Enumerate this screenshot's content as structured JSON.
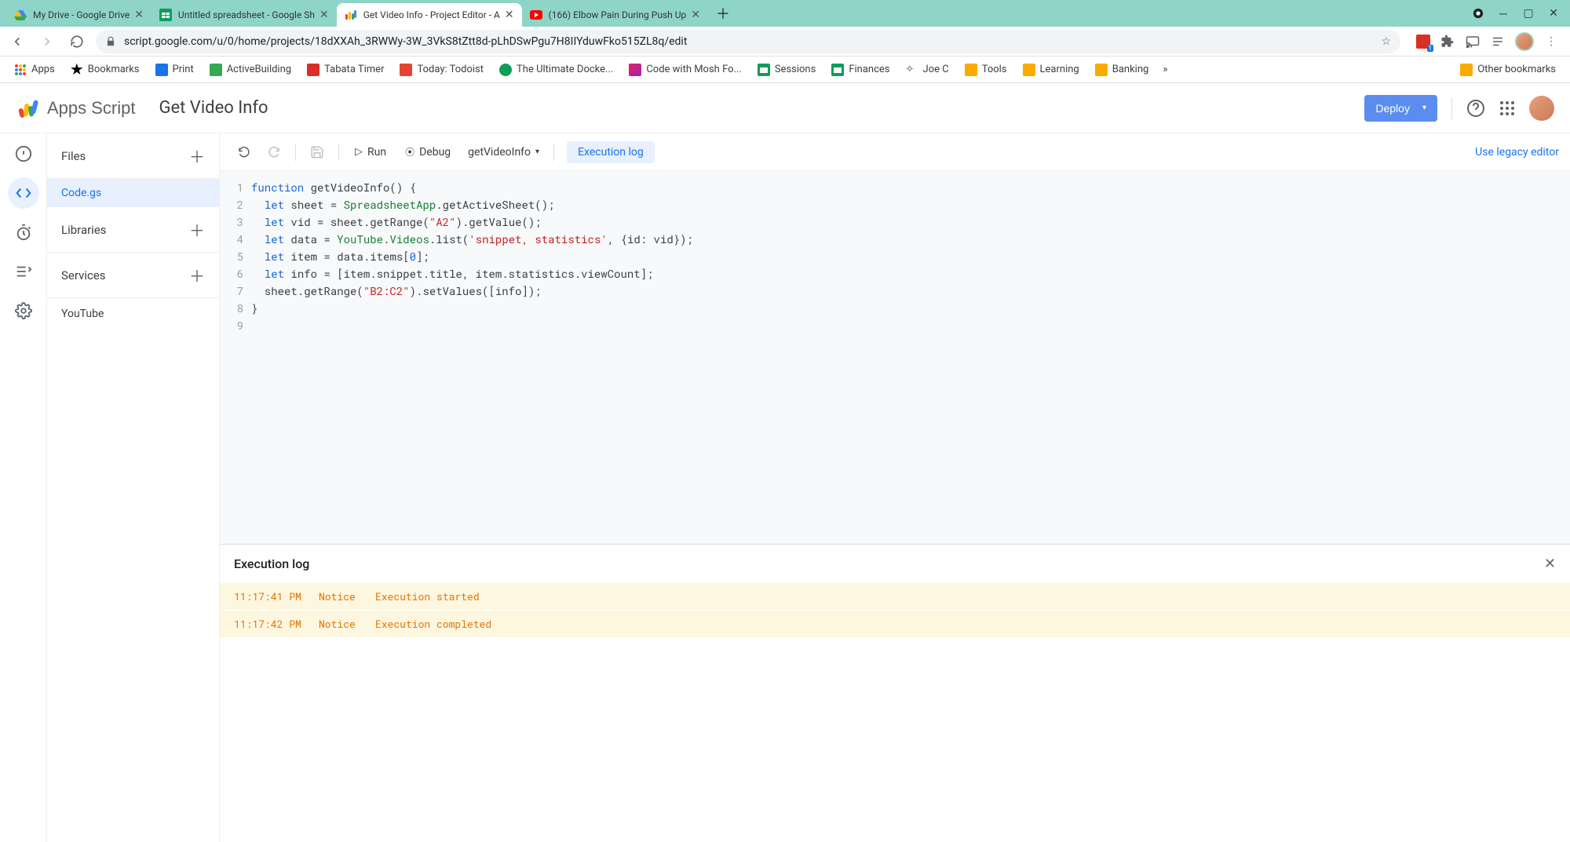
{
  "browser": {
    "tabs": [
      {
        "title": "My Drive - Google Drive",
        "favicon": "drive",
        "active": false
      },
      {
        "title": "Untitled spreadsheet - Google Sh",
        "favicon": "sheets",
        "active": false
      },
      {
        "title": "Get Video Info - Project Editor - A",
        "favicon": "script",
        "active": true
      },
      {
        "title": "(166) Elbow Pain During Push Up",
        "favicon": "youtube",
        "active": false
      }
    ],
    "url": "script.google.com/u/0/home/projects/18dXXAh_3RWWy-3W_3VkS8tZtt8d-pLhDSwPgu7H8IIYduwFko515ZL8q/edit",
    "bookmarks": [
      {
        "label": "Apps",
        "type": "apps"
      },
      {
        "label": "Bookmarks",
        "type": "star"
      },
      {
        "label": "Print",
        "type": "custom"
      },
      {
        "label": "ActiveBuilding",
        "type": "custom"
      },
      {
        "label": "Tabata Timer",
        "type": "custom"
      },
      {
        "label": "Today: Todoist",
        "type": "custom"
      },
      {
        "label": "The Ultimate Docke...",
        "type": "custom"
      },
      {
        "label": "Code with Mosh Fo...",
        "type": "custom"
      },
      {
        "label": "Sessions",
        "type": "sheets"
      },
      {
        "label": "Finances",
        "type": "sheets"
      },
      {
        "label": "Joe C",
        "type": "custom"
      },
      {
        "label": "Tools",
        "type": "folder"
      },
      {
        "label": "Learning",
        "type": "folder"
      },
      {
        "label": "Banking",
        "type": "folder"
      }
    ],
    "other_bookmarks": "Other bookmarks",
    "overflow": "»"
  },
  "header": {
    "brand": "Apps Script",
    "project_name": "Get Video Info",
    "deploy": "Deploy",
    "legacy_link": "Use legacy editor"
  },
  "rail": {
    "items": [
      "info",
      "editor",
      "triggers",
      "executions",
      "settings"
    ],
    "active": "editor"
  },
  "files_panel": {
    "files_label": "Files",
    "libraries_label": "Libraries",
    "services_label": "Services",
    "files": [
      "Code.gs"
    ],
    "services": [
      "YouTube"
    ]
  },
  "toolbar": {
    "run": "Run",
    "debug": "Debug",
    "function_selected": "getVideoInfo",
    "execution_log": "Execution log"
  },
  "code": {
    "line_count": 9,
    "tokens": [
      [
        {
          "t": "function",
          "c": "kw"
        },
        {
          "t": " getVideoInfo() {",
          "c": ""
        }
      ],
      [
        {
          "t": "  ",
          "c": ""
        },
        {
          "t": "let",
          "c": "kw"
        },
        {
          "t": " sheet = ",
          "c": ""
        },
        {
          "t": "SpreadsheetApp",
          "c": "cls"
        },
        {
          "t": ".getActiveSheet();",
          "c": ""
        }
      ],
      [
        {
          "t": "  ",
          "c": ""
        },
        {
          "t": "let",
          "c": "kw"
        },
        {
          "t": " vid = sheet.getRange(",
          "c": ""
        },
        {
          "t": "\"A2\"",
          "c": "str"
        },
        {
          "t": ").getValue();",
          "c": ""
        }
      ],
      [
        {
          "t": "  ",
          "c": ""
        },
        {
          "t": "let",
          "c": "kw"
        },
        {
          "t": " data = ",
          "c": ""
        },
        {
          "t": "YouTube",
          "c": "cls"
        },
        {
          "t": ".",
          "c": ""
        },
        {
          "t": "Videos",
          "c": "cls"
        },
        {
          "t": ".list(",
          "c": ""
        },
        {
          "t": "'snippet, statistics'",
          "c": "str"
        },
        {
          "t": ", {id: vid});",
          "c": ""
        }
      ],
      [
        {
          "t": "  ",
          "c": ""
        },
        {
          "t": "let",
          "c": "kw"
        },
        {
          "t": " item = data.items[",
          "c": ""
        },
        {
          "t": "0",
          "c": "num"
        },
        {
          "t": "];",
          "c": ""
        }
      ],
      [
        {
          "t": "  ",
          "c": ""
        },
        {
          "t": "let",
          "c": "kw"
        },
        {
          "t": " info = [item.snippet.title, item.statistics.viewCount];",
          "c": ""
        }
      ],
      [
        {
          "t": "  sheet.getRange(",
          "c": ""
        },
        {
          "t": "\"B2:C2\"",
          "c": "str"
        },
        {
          "t": ").setValues([info]);",
          "c": ""
        }
      ],
      [
        {
          "t": "}",
          "c": ""
        }
      ],
      [
        {
          "t": "",
          "c": ""
        }
      ]
    ]
  },
  "execution_log": {
    "title": "Execution log",
    "rows": [
      {
        "time": "11:17:41 PM",
        "level": "Notice",
        "msg": "Execution started"
      },
      {
        "time": "11:17:42 PM",
        "level": "Notice",
        "msg": "Execution completed"
      }
    ]
  }
}
